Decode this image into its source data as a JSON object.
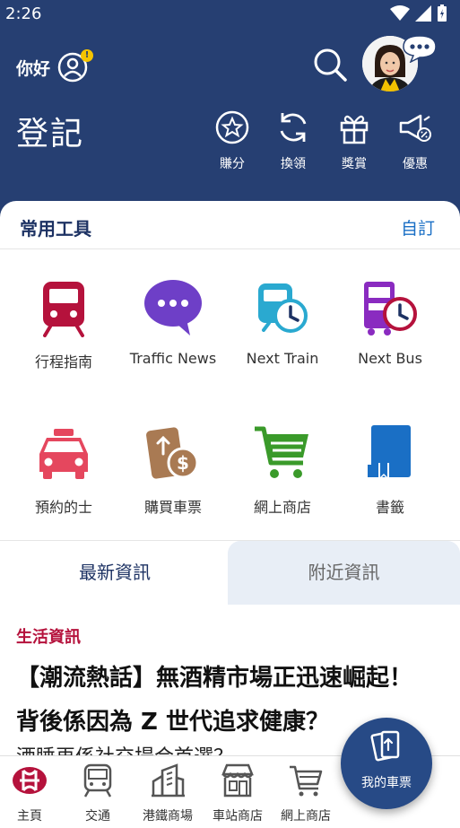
{
  "status_bar": {
    "time": "2:26"
  },
  "header": {
    "greeting": "你好",
    "notice_badge": "!",
    "page_title": "登記",
    "quick_actions": [
      {
        "label": "賺分",
        "icon": "star-circle-icon"
      },
      {
        "label": "換領",
        "icon": "refresh-icon"
      },
      {
        "label": "獎賞",
        "icon": "gift-icon"
      },
      {
        "label": "優惠",
        "icon": "megaphone-icon"
      }
    ]
  },
  "tools": {
    "title": "常用工具",
    "edit_label": "自訂",
    "items": [
      {
        "label": "行程指南",
        "icon": "train-icon"
      },
      {
        "label": "Traffic News",
        "icon": "chat-bubble-icon"
      },
      {
        "label": "Next Train",
        "icon": "next-train-icon"
      },
      {
        "label": "Next Bus",
        "icon": "next-bus-icon"
      },
      {
        "label": "預約的士",
        "icon": "taxi-icon"
      },
      {
        "label": "購買車票",
        "icon": "buy-ticket-icon"
      },
      {
        "label": "網上商店",
        "icon": "shopping-cart-icon"
      },
      {
        "label": "書籤",
        "icon": "bookmark-icon"
      }
    ]
  },
  "news": {
    "tabs": [
      "最新資訊",
      "附近資訊"
    ],
    "category": "生活資訊",
    "headline": "【潮流熱話】無酒精市場正迅速崛起！背後係因為 Z 世代追求健康？",
    "subline": "酒睡再係社交場合首選？"
  },
  "bottom_nav": {
    "items": [
      {
        "label": "主頁",
        "icon": "mtr-logo-icon"
      },
      {
        "label": "交通",
        "icon": "train-front-icon"
      },
      {
        "label": "港鐵商場",
        "icon": "mall-icon"
      },
      {
        "label": "車站商店",
        "icon": "shop-icon"
      },
      {
        "label": "網上商店",
        "icon": "cart-icon"
      }
    ],
    "ticket_button": "我的車票"
  },
  "colors": {
    "header_bg": "#263f72",
    "accent_red": "#b5123c",
    "link_blue": "#1a6fc5",
    "purple": "#6e3fc7",
    "teal": "#2aa9d0",
    "green": "#3a9a2a",
    "taxi_red": "#e5475e",
    "ticket_brown": "#a97a53",
    "bookmark_blue": "#1a6fc5"
  }
}
